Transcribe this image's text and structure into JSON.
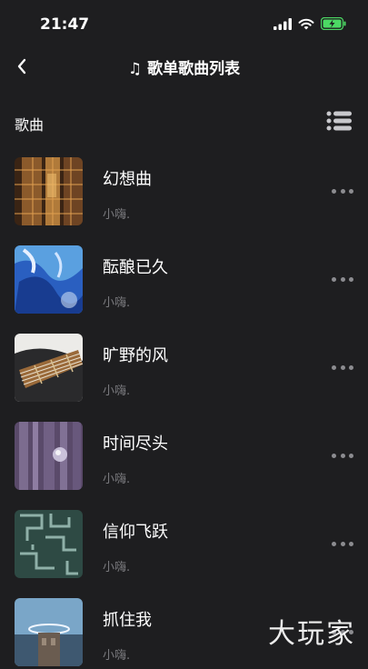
{
  "status_bar": {
    "time": "21:47",
    "icons": [
      "signal-icon",
      "wifi-icon",
      "battery-charging-icon"
    ]
  },
  "nav": {
    "title": "歌单歌曲列表",
    "title_icon": "music-note-icon",
    "back_icon": "chevron-left-icon"
  },
  "section": {
    "title": "歌曲",
    "list_icon": "list-icon"
  },
  "songs": [
    {
      "title": "幻想曲",
      "artist": "小嗨."
    },
    {
      "title": "酝酿已久",
      "artist": "小嗨."
    },
    {
      "title": "旷野的风",
      "artist": "小嗨."
    },
    {
      "title": "时间尽头",
      "artist": "小嗨."
    },
    {
      "title": "信仰飞跃",
      "artist": "小嗨."
    },
    {
      "title": "抓住我",
      "artist": "小嗨."
    }
  ],
  "watermark": "大玩家",
  "colors": {
    "background": "#1e1e20",
    "text": "#ffffff",
    "secondary_text": "#7a7a7e",
    "battery": "#4cd964"
  }
}
